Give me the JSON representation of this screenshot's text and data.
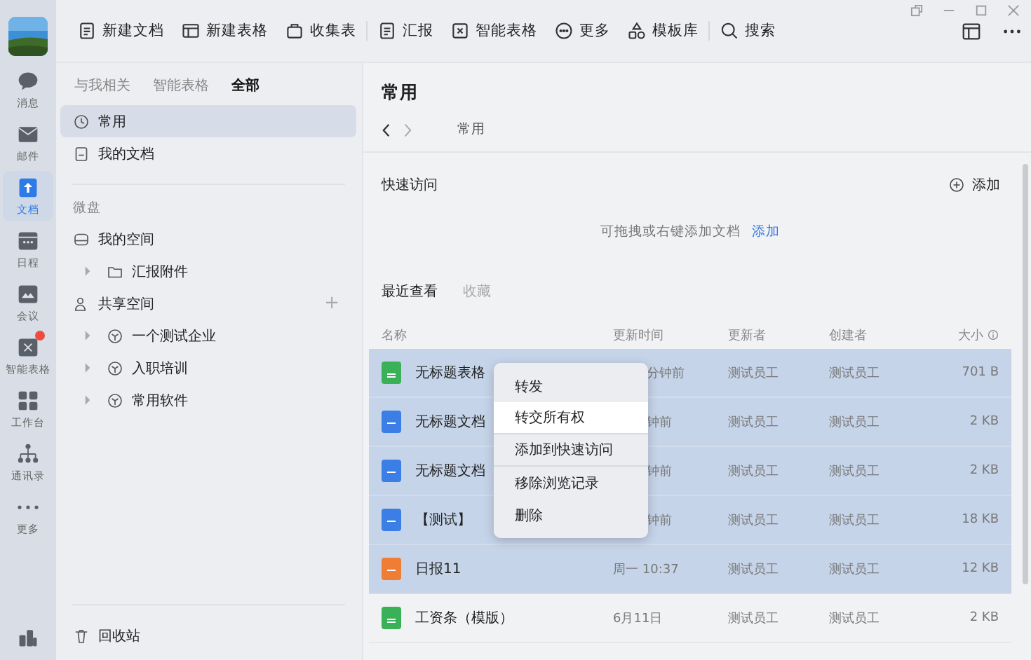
{
  "rail": {
    "items": [
      {
        "label": "消息",
        "selected": false,
        "badge": false
      },
      {
        "label": "邮件",
        "selected": false,
        "badge": false
      },
      {
        "label": "文档",
        "selected": true,
        "badge": false
      },
      {
        "label": "日程",
        "selected": false,
        "badge": false
      },
      {
        "label": "会议",
        "selected": false,
        "badge": false
      },
      {
        "label": "智能表格",
        "selected": false,
        "badge": true
      },
      {
        "label": "工作台",
        "selected": false,
        "badge": false
      },
      {
        "label": "通讯录",
        "selected": false,
        "badge": false
      },
      {
        "label": "更多",
        "selected": false,
        "badge": false
      }
    ]
  },
  "toolbar": [
    "新建文档",
    "新建表格",
    "收集表",
    "汇报",
    "智能表格",
    "更多",
    "模板库",
    "搜索"
  ],
  "sidebar": {
    "tabs": [
      {
        "label": "与我相关",
        "selected": false
      },
      {
        "label": "智能表格",
        "selected": false
      },
      {
        "label": "全部",
        "selected": true
      }
    ],
    "top_items": [
      {
        "label": "常用",
        "selected": true
      },
      {
        "label": "我的文档",
        "selected": false
      }
    ],
    "section_label": "微盘",
    "tree": [
      {
        "label": "我的空间",
        "children": [
          {
            "label": "汇报附件"
          }
        ]
      },
      {
        "label": "共享空间",
        "add": "+",
        "children": [
          {
            "label": "一个测试企业"
          },
          {
            "label": "入职培训"
          },
          {
            "label": "常用软件"
          }
        ]
      }
    ],
    "trash": "回收站"
  },
  "main": {
    "title": "常用",
    "breadcrumb": "常用",
    "quick_access": {
      "title": "快速访问",
      "add": "添加",
      "hint": "可拖拽或右键添加文档",
      "hint_link": "添加"
    },
    "tabs": [
      {
        "label": "最近查看",
        "selected": true
      },
      {
        "label": "收藏",
        "selected": false
      }
    ],
    "columns": [
      "名称",
      "更新时间",
      "更新者",
      "创建者",
      "大小"
    ],
    "rows": [
      {
        "name": "无标题表格",
        "kind": "sheet",
        "time": "分钟前",
        "time_covered": true,
        "updater": "测试员工",
        "creator": "测试员工",
        "size": "701 B",
        "selected": true
      },
      {
        "name": "无标题文档",
        "kind": "doc",
        "time": "钟前",
        "time_covered": true,
        "updater": "测试员工",
        "creator": "测试员工",
        "size": "2 KB",
        "selected": true
      },
      {
        "name": "无标题文档",
        "kind": "doc",
        "time": "钟前",
        "time_covered": true,
        "updater": "测试员工",
        "creator": "测试员工",
        "size": "2 KB",
        "selected": true
      },
      {
        "name": "【测试】",
        "kind": "doc",
        "time": "钟前",
        "time_covered": true,
        "updater": "测试员工",
        "creator": "测试员工",
        "size": "18 KB",
        "selected": true
      },
      {
        "name": "日报11",
        "kind": "report",
        "time": "周一 10:37",
        "time_covered": false,
        "updater": "测试员工",
        "creator": "测试员工",
        "size": "12 KB",
        "selected": true
      },
      {
        "name": "工资条（模版）",
        "kind": "sheet",
        "time": "6月11日",
        "time_covered": false,
        "updater": "测试员工",
        "creator": "测试员工",
        "size": "2 KB",
        "selected": false
      }
    ]
  },
  "context_menu": [
    {
      "label": "转发",
      "selected": false,
      "divider_after": false
    },
    {
      "label": "转交所有权",
      "selected": true,
      "divider_after": true
    },
    {
      "label": "添加到快速访问",
      "selected": false,
      "divider_after": true
    },
    {
      "label": "移除浏览记录",
      "selected": false,
      "divider_after": false
    },
    {
      "label": "删除",
      "selected": false,
      "divider_after": false
    }
  ]
}
